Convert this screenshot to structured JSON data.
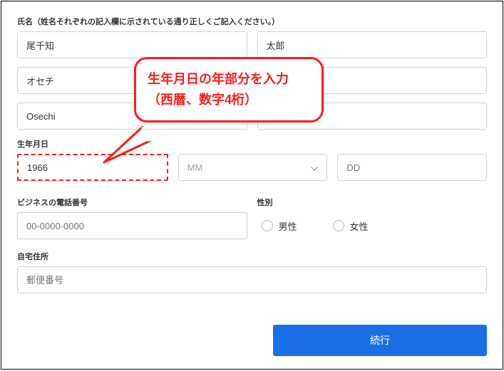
{
  "labels": {
    "name_section": "氏名（姓名それぞれの記入欄に示されている通り正しくご記入ください。）",
    "dob": "生年月日",
    "business_phone": "ビジネスの電話番号",
    "gender": "性別",
    "home_address": "自宅住所"
  },
  "name": {
    "last_kanji": "尾千知",
    "first_kanji": "太郎",
    "last_kana": "オセチ",
    "first_kana": "",
    "last_roman": "Osechi",
    "first_roman": ""
  },
  "dob_fields": {
    "year_value": "1966",
    "month_placeholder": "MM",
    "day_placeholder": "DD"
  },
  "phone": {
    "placeholder": "00-0000-0000"
  },
  "gender_options": {
    "male": "男性",
    "female": "女性"
  },
  "address": {
    "postal_placeholder": "郵便番号"
  },
  "button": {
    "continue": "続行"
  },
  "callout": {
    "line1": "生年月日の年部分を入力",
    "line2": "（西暦、数字4桁）"
  }
}
